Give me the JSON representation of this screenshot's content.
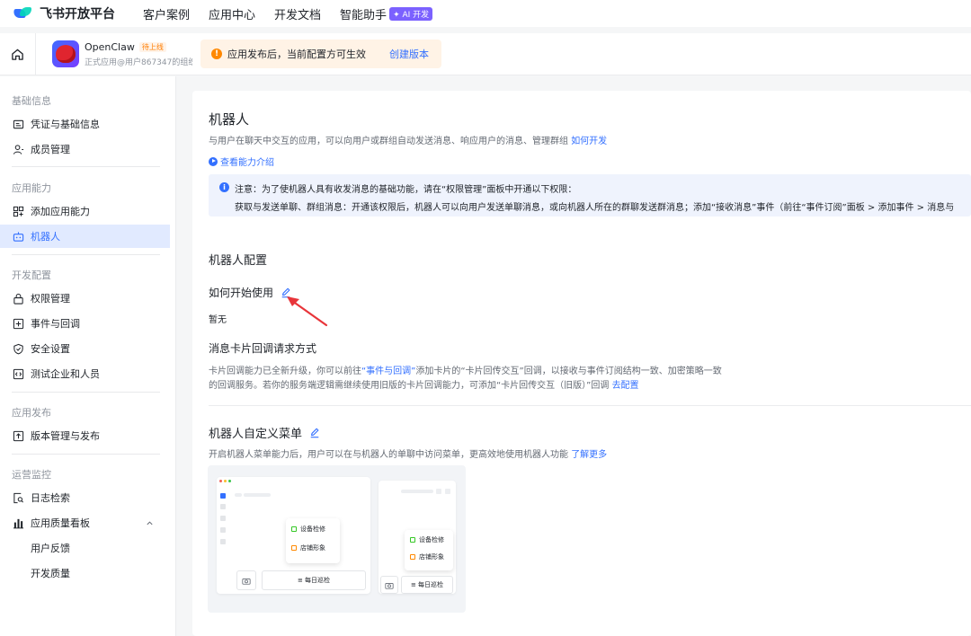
{
  "topnav": {
    "brand": "飞书开放平台",
    "links": [
      "客户案例",
      "应用中心",
      "开发文档",
      "智能助手"
    ],
    "ai_badge": "✦ AI 开发"
  },
  "appbar": {
    "app_name": "OpenClaw",
    "status_badge": "待上线",
    "app_sub": "正式应用@用户867347的组织",
    "notice_text": "应用发布后，当前配置方可生效",
    "notice_link": "创建版本"
  },
  "sidebar": {
    "sections": [
      {
        "title": "基础信息",
        "items": [
          "凭证与基础信息",
          "成员管理"
        ]
      },
      {
        "title": "应用能力",
        "items": [
          "添加应用能力",
          "机器人"
        ]
      },
      {
        "title": "开发配置",
        "items": [
          "权限管理",
          "事件与回调",
          "安全设置",
          "测试企业和人员"
        ]
      },
      {
        "title": "应用发布",
        "items": [
          "版本管理与发布"
        ]
      },
      {
        "title": "运营监控",
        "items": [
          "日志检索",
          "应用质量看板",
          "用户反馈",
          "开发质量"
        ]
      }
    ],
    "active": "机器人"
  },
  "content": {
    "title": "机器人",
    "description": "与用户在聊天中交互的应用，可以向用户或群组自动发送消息、响应用户的消息、管理群组",
    "description_link": "如何开发",
    "capability_link": "查看能力介绍",
    "info_line1": "注意：为了使机器人具有收发消息的基础功能，请在“权限管理”面板中开通以下权限：",
    "info_line2": "获取与发送单聊、群组消息：开通该权限后，机器人可以向用户发送单聊消息，或向机器人所在的群聊发送群消息；添加“接收消息”事件（前往“事件订阅”面板 > 添加事件 > 消息与",
    "config_title": "机器人配置",
    "how_to_start": "如何开始使用",
    "none": "暂无",
    "callback_title": "消息卡片回调请求方式",
    "callback_desc1_a": "卡片回调能力已全新升级，你可以前往",
    "callback_desc1_link": "“事件与回调”",
    "callback_desc1_b": "添加卡片的“卡片回传交互”回调，以接收与事件订阅结构一致、加密策略一致",
    "callback_desc2": "的回调服务。若你的服务端逻辑需继续使用旧版的卡片回调能力，可添加“卡片回传交互（旧版）”回调",
    "callback_link": "去配置",
    "menu_title": "机器人自定义菜单",
    "menu_desc": "开启机器人菜单能力后，用户可以在与机器人的单聊中访问菜单，更高效地使用机器人功能",
    "menu_link": "了解更多"
  },
  "preview": {
    "item1": "设备检修",
    "item2": "店铺形象",
    "bottom": "≡ 每日巡检"
  },
  "colors": {
    "accent": "#3370ff",
    "warning": "#ff8800",
    "active_bg": "#e1eaff",
    "annotation_arrow": "#e8353a"
  }
}
